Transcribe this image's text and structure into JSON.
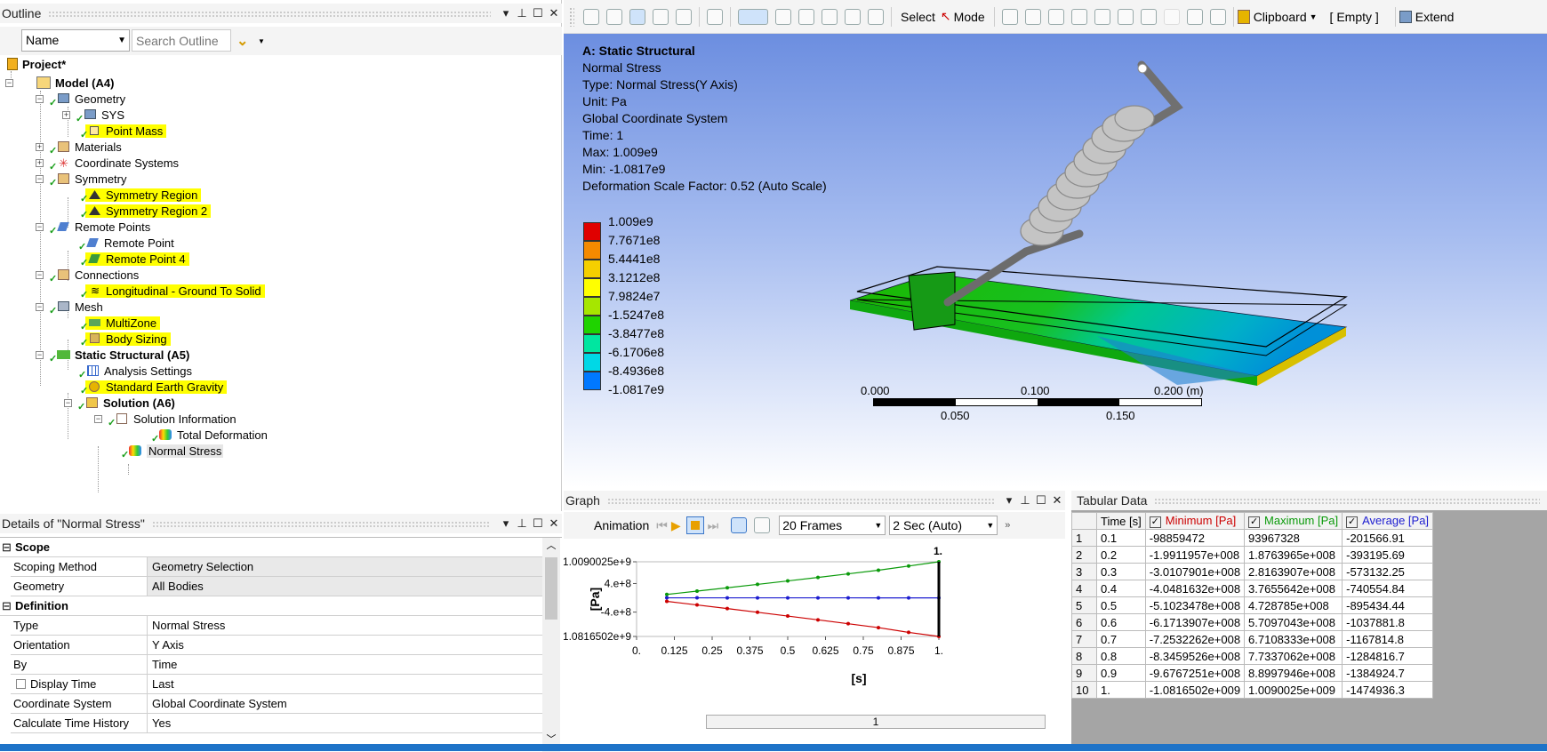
{
  "outline": {
    "title": "Outline",
    "filter_select": "Name",
    "search_placeholder": "Search Outline",
    "tree": {
      "project": "Project*",
      "model": "Model (A4)",
      "geometry": "Geometry",
      "sys": "SYS",
      "point_mass": "Point Mass",
      "materials": "Materials",
      "coordinate_systems": "Coordinate Systems",
      "symmetry": "Symmetry",
      "symmetry_region": "Symmetry Region",
      "symmetry_region_2": "Symmetry Region 2",
      "remote_points": "Remote Points",
      "remote_point": "Remote Point",
      "remote_point_4": "Remote Point 4",
      "connections": "Connections",
      "longitudinal": "Longitudinal - Ground To Solid",
      "mesh": "Mesh",
      "multizone": "MultiZone",
      "body_sizing": "Body Sizing",
      "static_structural": "Static Structural (A5)",
      "analysis_settings": "Analysis Settings",
      "earth_gravity": "Standard Earth Gravity",
      "solution": "Solution (A6)",
      "solution_information": "Solution Information",
      "total_deformation": "Total Deformation",
      "normal_stress": "Normal Stress"
    }
  },
  "details": {
    "title": "Details of \"Normal Stress\"",
    "sections": {
      "scope": "Scope",
      "definition": "Definition"
    },
    "rows": [
      {
        "key": "Scoping Method",
        "value": "Geometry Selection"
      },
      {
        "key": "Geometry",
        "value": "All Bodies"
      },
      {
        "key": "Type",
        "value": "Normal Stress"
      },
      {
        "key": "Orientation",
        "value": "Y Axis"
      },
      {
        "key": "By",
        "value": "Time"
      },
      {
        "key": "Display Time",
        "value": "Last"
      },
      {
        "key": "Coordinate System",
        "value": "Global Coordinate System"
      },
      {
        "key": "Calculate Time History",
        "value": "Yes"
      }
    ]
  },
  "toolbar": {
    "select": "Select",
    "mode": "Mode",
    "clipboard": "Clipboard",
    "empty": "[ Empty ]",
    "extend": "Extend"
  },
  "viewport": {
    "info": [
      "A: Static Structural",
      "Normal Stress",
      "Type: Normal Stress(Y Axis)",
      "Unit: Pa",
      "Global Coordinate System",
      "Time: 1",
      "Max: 1.009e9",
      "Min: -1.0817e9",
      "Deformation Scale Factor: 0.52 (Auto Scale)"
    ],
    "legend": [
      {
        "label": "1.009e9",
        "color": "#e00000"
      },
      {
        "label": "7.7671e8",
        "color": "#f58a00"
      },
      {
        "label": "5.4441e8",
        "color": "#f5cf00"
      },
      {
        "label": "3.1212e8",
        "color": "#ffff00"
      },
      {
        "label": "7.9824e7",
        "color": "#a6e600"
      },
      {
        "label": "-1.5247e8",
        "color": "#1fd300"
      },
      {
        "label": "-3.8477e8",
        "color": "#00e6a0"
      },
      {
        "label": "-6.1706e8",
        "color": "#00d8e6"
      },
      {
        "label": "-8.4936e8",
        "color": "#0078ff"
      },
      {
        "label": "-1.0817e9",
        "color": "#0000d8"
      }
    ],
    "scale": {
      "top": [
        "0.000",
        "0.100",
        "0.200 (m)"
      ],
      "bottom": [
        "0.050",
        "0.150"
      ]
    }
  },
  "graph": {
    "title": "Graph",
    "animation": "Animation",
    "frames": "20 Frames",
    "duration": "2 Sec (Auto)",
    "ylabel": "[Pa]",
    "xlabel": "[s]",
    "marker": "1.",
    "page": "1"
  },
  "chart_data": {
    "type": "line",
    "x": [
      0.1,
      0.2,
      0.3,
      0.4,
      0.5,
      0.6,
      0.7,
      0.8,
      0.9,
      1.0
    ],
    "series": [
      {
        "name": "Minimum [Pa]",
        "color": "#cc0000",
        "values": [
          -98859472,
          -199119570,
          -301079010,
          -404816320,
          -510234780,
          -617139070,
          -725322620,
          -834592600,
          -967672510,
          -1081650200
        ]
      },
      {
        "name": "Maximum [Pa]",
        "color": "#0a9a0a",
        "values": [
          93967328,
          187639650,
          281639070,
          376556420,
          472878500,
          570970430,
          671083330,
          773370620,
          889979460,
          1009002500
        ]
      },
      {
        "name": "Average [Pa]",
        "color": "#1c1cd0",
        "values": [
          -201566.91,
          -393195.69,
          -573132.25,
          -740554.84,
          -895434.44,
          -1037881.8,
          -1167814.8,
          -1284816.7,
          -1384924.7,
          -1474936.3
        ]
      }
    ],
    "yticks": [
      "1.0090025e+9",
      "4.e+8",
      "-4.e+8",
      "-1.0816502e+9"
    ],
    "ytick_values": [
      1009002500,
      400000000,
      -400000000,
      -1081650200
    ],
    "xticks": [
      "0.",
      "0.125",
      "0.25",
      "0.375",
      "0.5",
      "0.625",
      "0.75",
      "0.875",
      "1."
    ],
    "xtick_values": [
      0,
      0.125,
      0.25,
      0.375,
      0.5,
      0.625,
      0.75,
      0.875,
      1
    ],
    "xlabel": "[s]",
    "ylabel": "[Pa]",
    "xlim": [
      0,
      1
    ],
    "ylim": [
      -1081650200,
      1009002500
    ]
  },
  "tabular": {
    "title": "Tabular Data",
    "headers": [
      "Time [s]",
      "Minimum [Pa]",
      "Maximum [Pa]",
      "Average [Pa]"
    ],
    "rows": [
      [
        "1",
        "0.1",
        "-98859472",
        "93967328",
        "-201566.91"
      ],
      [
        "2",
        "0.2",
        "-1.9911957e+008",
        "1.8763965e+008",
        "-393195.69"
      ],
      [
        "3",
        "0.3",
        "-3.0107901e+008",
        "2.8163907e+008",
        "-573132.25"
      ],
      [
        "4",
        "0.4",
        "-4.0481632e+008",
        "3.7655642e+008",
        "-740554.84"
      ],
      [
        "5",
        "0.5",
        "-5.1023478e+008",
        "4.728785e+008",
        "-895434.44"
      ],
      [
        "6",
        "0.6",
        "-6.1713907e+008",
        "5.7097043e+008",
        "-1037881.8"
      ],
      [
        "7",
        "0.7",
        "-7.2532262e+008",
        "6.7108333e+008",
        "-1167814.8"
      ],
      [
        "8",
        "0.8",
        "-8.3459526e+008",
        "7.7337062e+008",
        "-1284816.7"
      ],
      [
        "9",
        "0.9",
        "-9.6767251e+008",
        "8.8997946e+008",
        "-1384924.7"
      ],
      [
        "10",
        "1.",
        "-1.0816502e+009",
        "1.0090025e+009",
        "-1474936.3"
      ]
    ]
  }
}
